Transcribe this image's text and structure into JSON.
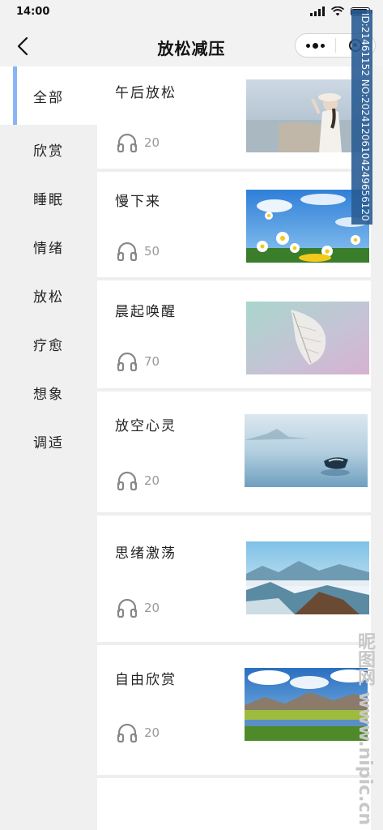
{
  "status_bar": {
    "time": "14:00"
  },
  "nav": {
    "title": "放松减压"
  },
  "sidebar": {
    "items": [
      {
        "label": "全部"
      },
      {
        "label": "欣赏"
      },
      {
        "label": "睡眠"
      },
      {
        "label": "情绪"
      },
      {
        "label": "放松"
      },
      {
        "label": "疗愈"
      },
      {
        "label": "想象"
      },
      {
        "label": "调适"
      }
    ]
  },
  "list": {
    "items": [
      {
        "title": "午后放松",
        "count": "20",
        "image": "woman-on-beach"
      },
      {
        "title": "慢下来",
        "count": "50",
        "image": "daisies-blue-sky"
      },
      {
        "title": "晨起唤醒",
        "count": "70",
        "image": "translucent-leaf"
      },
      {
        "title": "放空心灵",
        "count": "20",
        "image": "boat-on-misty-lake"
      },
      {
        "title": "思绪激荡",
        "count": "20",
        "image": "mountains-above-clouds"
      },
      {
        "title": "自由欣赏",
        "count": "20",
        "image": "grassland-lake-mountains"
      }
    ]
  },
  "watermark": {
    "id_text": "ID:21461152 NO:20241206104249656120",
    "site": "昵图网 www.nipic.cn"
  },
  "colors": {
    "accent": "#8ab4f8",
    "background": "#f0f0f0",
    "card": "#ffffff",
    "muted": "#999999"
  }
}
